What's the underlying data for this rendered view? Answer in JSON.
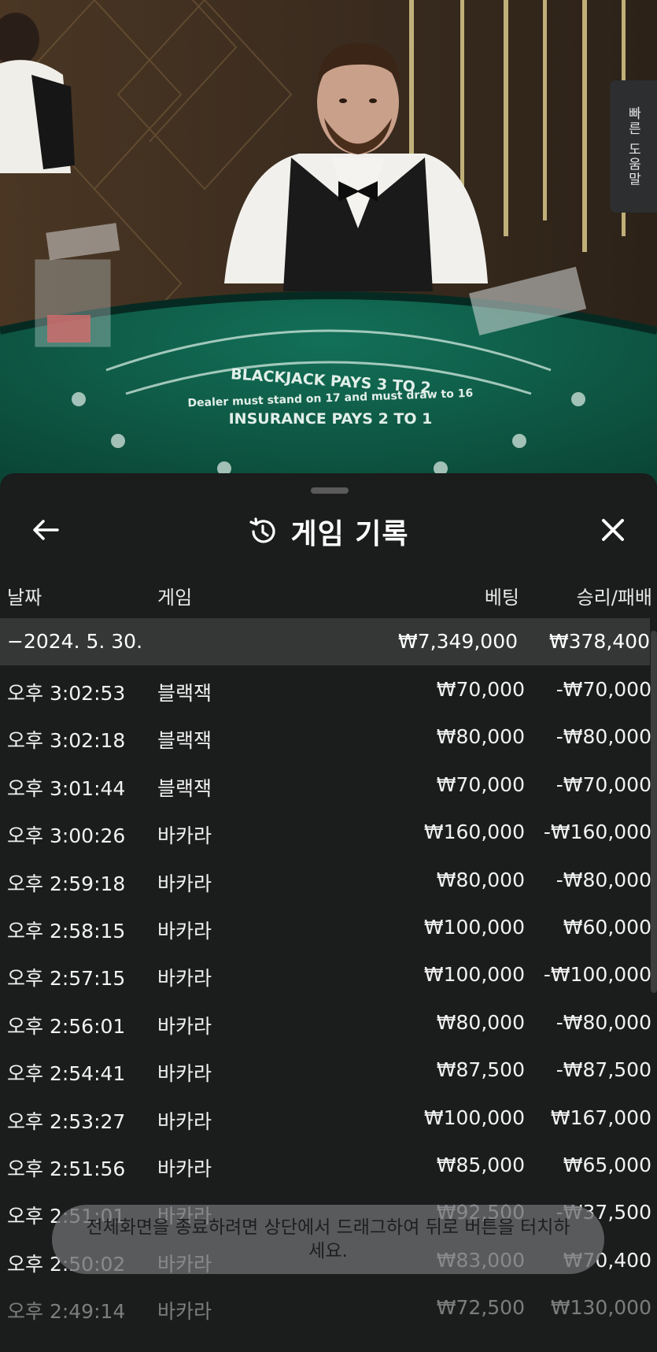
{
  "help_tab": {
    "label": "빠른 도움말"
  },
  "table_felt": {
    "line1": "BLACKJACK PAYS 3 TO 2",
    "line2": "Dealer must stand on 17 and must draw to 16",
    "line3": "INSURANCE PAYS 2 TO 1"
  },
  "sheet": {
    "title": "게임 기록",
    "columns": {
      "date": "날짜",
      "game": "게임",
      "bet": "베팅",
      "result": "승리/패배"
    },
    "summary": {
      "date": "−2024. 5. 30.",
      "bet": "₩7,349,000",
      "result": "₩378,400"
    },
    "rows": [
      {
        "time": "오후 3:02:53",
        "game": "블랙잭",
        "bet": "₩70,000",
        "result": "-₩70,000"
      },
      {
        "time": "오후 3:02:18",
        "game": "블랙잭",
        "bet": "₩80,000",
        "result": "-₩80,000"
      },
      {
        "time": "오후 3:01:44",
        "game": "블랙잭",
        "bet": "₩70,000",
        "result": "-₩70,000"
      },
      {
        "time": "오후 3:00:26",
        "game": "바카라",
        "bet": "₩160,000",
        "result": "-₩160,000"
      },
      {
        "time": "오후 2:59:18",
        "game": "바카라",
        "bet": "₩80,000",
        "result": "-₩80,000"
      },
      {
        "time": "오후 2:58:15",
        "game": "바카라",
        "bet": "₩100,000",
        "result": "₩60,000"
      },
      {
        "time": "오후 2:57:15",
        "game": "바카라",
        "bet": "₩100,000",
        "result": "-₩100,000"
      },
      {
        "time": "오후 2:56:01",
        "game": "바카라",
        "bet": "₩80,000",
        "result": "-₩80,000"
      },
      {
        "time": "오후 2:54:41",
        "game": "바카라",
        "bet": "₩87,500",
        "result": "-₩87,500"
      },
      {
        "time": "오후 2:53:27",
        "game": "바카라",
        "bet": "₩100,000",
        "result": "₩167,000"
      },
      {
        "time": "오후 2:51:56",
        "game": "바카라",
        "bet": "₩85,000",
        "result": "₩65,000"
      },
      {
        "time": "오후 2:51:01",
        "game": "바카라",
        "bet": "₩92,500",
        "result": "-₩37,500"
      },
      {
        "time": "오후 2:50:02",
        "game": "바카라",
        "bet": "₩83,000",
        "result": "₩70,400"
      },
      {
        "time": "오후 2:49:14",
        "game": "바카라",
        "bet": "₩72,500",
        "result": "₩130,000"
      }
    ]
  },
  "toast": {
    "text": "전체화면을 종료하려면 상단에서 드래그하여 뒤로 버튼을 터치하세요."
  },
  "icons": {
    "back": "arrow-left-icon",
    "history": "history-icon",
    "close": "close-icon"
  },
  "colors": {
    "sheet_bg": "#1b1c1c",
    "summary_bg": "#353737",
    "felt": "#0f5a45",
    "text": "#ffffff"
  }
}
